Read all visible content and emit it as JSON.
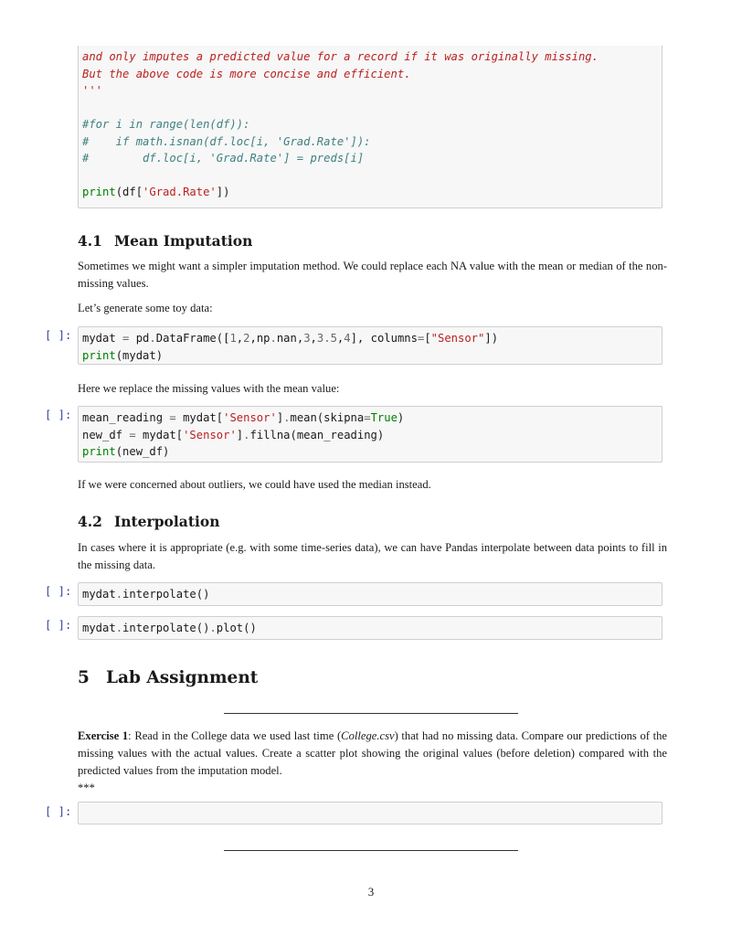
{
  "code_cell_0": {
    "docstring_lines": [
      "and only imputes a predicted value for a record if it was originally missing.",
      "But the above code is more concise and efficient.",
      "'''"
    ],
    "comment_lines": [
      "#for i in range(len(df)):",
      "#    if math.isnan(df.loc[i, 'Grad.Rate']):",
      "#        df.loc[i, 'Grad.Rate'] = preds[i]"
    ],
    "print_fn": "print",
    "print_open": "(df[",
    "print_str": "'Grad.Rate'",
    "print_close": "])"
  },
  "section_4_1": {
    "number": "4.1",
    "title": "Mean Imputation",
    "para1": "Sometimes we might want a simpler imputation method. We could replace each NA value with the mean or median of the non-missing values.",
    "para2": "Let’s generate some toy data:"
  },
  "code_cell_1": {
    "prompt": "[ ]:",
    "line1": {
      "a": "mydat ",
      "eq": "=",
      "b": " pd",
      "dot": ".",
      "c": "DataFrame([",
      "n1": "1",
      "comma1": ",",
      "n2": "2",
      "comma2": ",np",
      "dot2": ".",
      "nan": "nan,",
      "n3": "3",
      "comma3": ",",
      "n4": "3.5",
      "comma4": ",",
      "n5": "4",
      "d": "], columns",
      "eq2": "=",
      "e": "[",
      "str": "\"Sensor\"",
      "f": "])"
    },
    "line2": {
      "fn": "print",
      "rest": "(mydat)"
    }
  },
  "para_mean": "Here we replace the missing values with the mean value:",
  "code_cell_2": {
    "prompt": "[ ]:",
    "line1": {
      "a": "mean_reading ",
      "eq": "=",
      "b": " mydat[",
      "str": "'Sensor'",
      "c": "]",
      "dot": ".",
      "d": "mean(skipna",
      "eq2": "=",
      "kw": "True",
      "e": ")"
    },
    "line2": {
      "a": "new_df ",
      "eq": "=",
      "b": " mydat[",
      "str": "'Sensor'",
      "c": "]",
      "dot": ".",
      "d": "fillna(mean_reading)"
    },
    "line3": {
      "fn": "print",
      "rest": "(new_df)"
    }
  },
  "para_outliers": "If we were concerned about outliers, we could have used the median instead.",
  "section_4_2": {
    "number": "4.2",
    "title": "Interpolation",
    "para": "In cases where it is appropriate (e.g. with some time-series data), we can have Pandas interpolate between data points to fill in the missing data."
  },
  "code_cell_3": {
    "prompt": "[ ]:",
    "a": "mydat",
    "dot": ".",
    "b": "interpolate()"
  },
  "code_cell_4": {
    "prompt": "[ ]:",
    "a": "mydat",
    "dot": ".",
    "b": "interpolate()",
    "dot2": ".",
    "c": "plot()"
  },
  "section_5": {
    "number": "5",
    "title": "Lab Assignment"
  },
  "exercise_1": {
    "label": "Exercise 1",
    "text_a": ": Read in the College data we used last time (",
    "file": "College.csv",
    "text_b": ") that had no missing data. Compare our predictions of the missing values with the actual values. Create a scatter plot showing the original values (before deletion) compared with the predicted values from the imputation model.",
    "stars": "***"
  },
  "code_cell_5": {
    "prompt": "[ ]:",
    "value": ""
  },
  "page_number": "3"
}
